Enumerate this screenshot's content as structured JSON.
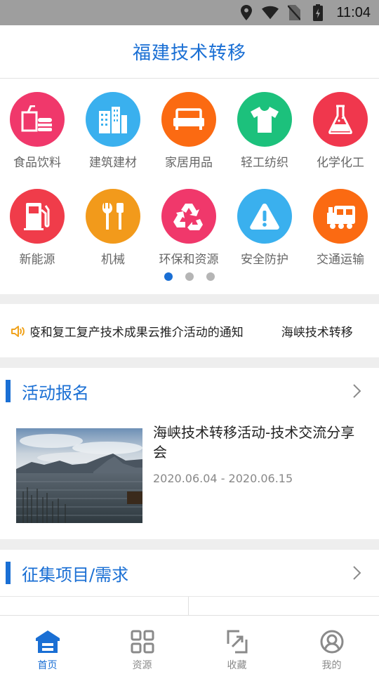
{
  "status_bar": {
    "time": "11:04"
  },
  "header": {
    "title": "福建技术转移"
  },
  "categories": [
    {
      "label": "食品饮料",
      "color": "#f0386b",
      "icon": "food-drink-icon"
    },
    {
      "label": "建筑建材",
      "color": "#3ab0ee",
      "icon": "building-icon"
    },
    {
      "label": "家居用品",
      "color": "#fb6a12",
      "icon": "sofa-icon"
    },
    {
      "label": "轻工纺织",
      "color": "#1cc17c",
      "icon": "tshirt-icon"
    },
    {
      "label": "化学化工",
      "color": "#f0374d",
      "icon": "flask-icon"
    },
    {
      "label": "新能源",
      "color": "#f03c4a",
      "icon": "fuel-pump-icon"
    },
    {
      "label": "机械",
      "color": "#f29a1b",
      "icon": "tools-icon"
    },
    {
      "label": "环保和资源",
      "color": "#f0386b",
      "icon": "recycle-icon"
    },
    {
      "label": "安全防护",
      "color": "#3ab0ee",
      "icon": "warning-icon"
    },
    {
      "label": "交通运输",
      "color": "#fb6a12",
      "icon": "train-icon"
    }
  ],
  "pager": {
    "pages": 3,
    "active": 0
  },
  "notice": {
    "items": [
      "i疫和复工复产技术成果云推介活动的通知",
      "海峡技术转移"
    ]
  },
  "activity": {
    "section_title": "活动报名",
    "item": {
      "title": "海峡技术转移活动-技术交流分享会",
      "date": "2020.06.04 - 2020.06.15"
    }
  },
  "collect": {
    "section_title": "征集项目/需求"
  },
  "tabs": [
    {
      "label": "首页",
      "icon": "home-icon",
      "active": true
    },
    {
      "label": "资源",
      "icon": "grid-icon",
      "active": false
    },
    {
      "label": "收藏",
      "icon": "collect-icon",
      "active": false
    },
    {
      "label": "我的",
      "icon": "profile-icon",
      "active": false
    }
  ],
  "colors": {
    "accent": "#1a6fd4",
    "speaker": "#f0a21b"
  }
}
